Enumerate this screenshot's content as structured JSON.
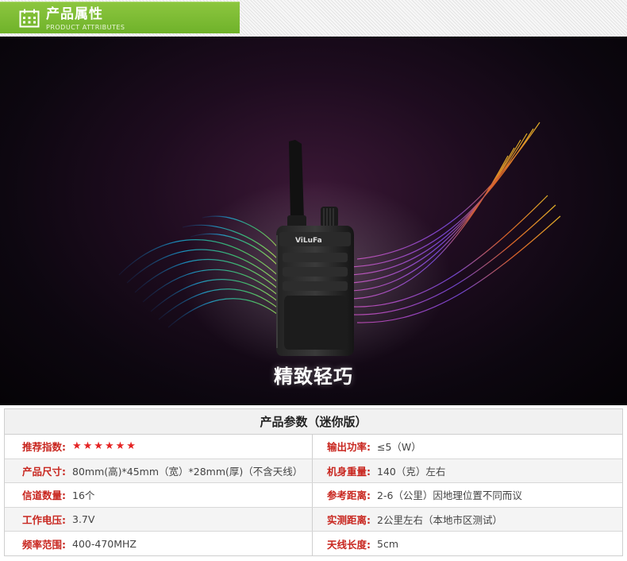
{
  "header": {
    "title": "产品属性",
    "subtitle": "PRODUCT ATTRIBUTES",
    "icon": "calendar-icon",
    "accent": "#7ab833"
  },
  "banner": {
    "caption": "精致轻巧",
    "brand": "ViLuFa"
  },
  "spec": {
    "title": "产品参数（迷你版）",
    "rows": [
      {
        "left_label": "推荐指数:",
        "left_value": "★★★★★★",
        "right_label": "输出功率:",
        "right_value": "≤5（W）"
      },
      {
        "left_label": "产品尺寸:",
        "left_value": "80mm(高)*45mm（宽）*28mm(厚)（不含天线）",
        "right_label": "机身重量:",
        "right_value": "140（克）左右"
      },
      {
        "left_label": "信道数量:",
        "left_value": "16个",
        "right_label": "参考距离:",
        "right_value": "2-6（公里）因地理位置不同而议"
      },
      {
        "left_label": "工作电压:",
        "left_value": "3.7V",
        "right_label": "实测距离:",
        "right_value": "2公里左右（本地市区测试）"
      },
      {
        "left_label": "频率范围:",
        "left_value": "400-470MHZ",
        "right_label": "天线长度:",
        "right_value": "5cm"
      }
    ],
    "label_color": "#c8261f",
    "star_color": "#e52222",
    "rating_stars": 6
  }
}
